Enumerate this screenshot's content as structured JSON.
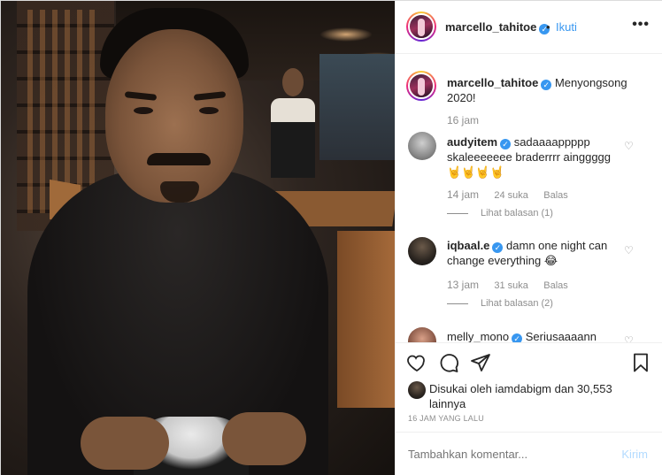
{
  "post": {
    "username": "marcello_tahitoe",
    "dot": "•",
    "follow_label": "Ikuti",
    "more_label": "•••",
    "caption": {
      "username": "marcello_tahitoe",
      "text": "Menyongsong 2020!",
      "time": "16 jam"
    }
  },
  "comments": [
    {
      "username": "audyitem",
      "text": "sadaaaappppp skaleeeeeee braderrrr ainggggg",
      "emoji": "🤘🤘🤘🤘",
      "time": "14 jam",
      "likes": "24 suka",
      "reply_label": "Balas",
      "view_replies": "Lihat balasan (1)"
    },
    {
      "username": "iqbaal.e",
      "text": "damn one night can change everything",
      "emoji": "😂",
      "time": "13 jam",
      "likes": "31 suka",
      "reply_label": "Balas",
      "view_replies": "Lihat balasan (2)"
    },
    {
      "username": "melly_mono",
      "text": "Seriusaaaann"
    }
  ],
  "icons": {
    "like": "heart-icon",
    "comment": "comment-icon",
    "share": "share-icon",
    "save": "bookmark-icon",
    "comment_like": "heart-icon"
  },
  "likes": {
    "text": "Disukai oleh iamdabigm dan 30,553 lainnya"
  },
  "timestamp": "16 JAM YANG LALU",
  "add_comment": {
    "placeholder": "Tambahkan komentar...",
    "post_label": "Kirim"
  },
  "colors": {
    "accent": "#3897f0",
    "muted": "#8e8e8e",
    "text": "#262626",
    "post_disabled": "#b3dbff"
  }
}
